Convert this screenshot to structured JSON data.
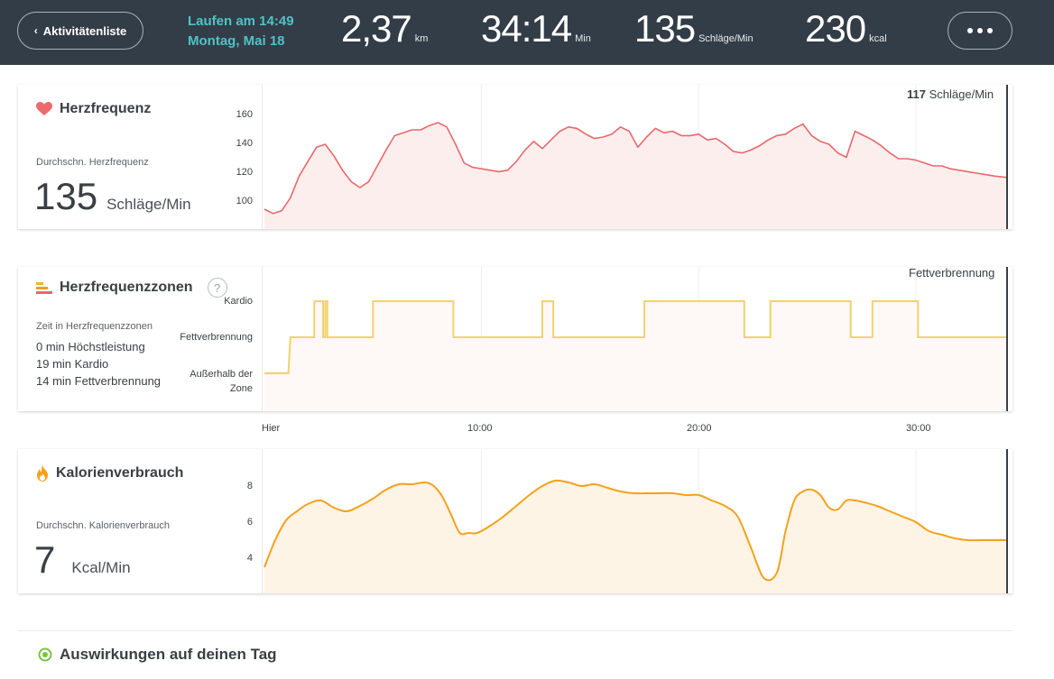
{
  "header": {
    "back_label": "Aktivitätenliste",
    "activity_line1": "Laufen am 14:49",
    "activity_line2": "Montag, Mai 18",
    "stats": [
      {
        "value": "2,37",
        "unit": "km"
      },
      {
        "value": "34:14",
        "unit": "Min"
      },
      {
        "value": "135",
        "unit": "Schläge/Min"
      },
      {
        "value": "230",
        "unit": "kcal"
      }
    ],
    "more_label": "•••"
  },
  "heart_rate": {
    "title": "Herzfrequenz",
    "sub_label": "Durchschn. Herzfrequenz",
    "avg_value": "135",
    "avg_unit": "Schläge/Min",
    "y_ticks": [
      "160",
      "140",
      "120",
      "100"
    ],
    "cursor_value": "117",
    "cursor_unit": "Schläge/Min",
    "color": "#e8686b"
  },
  "zones": {
    "title": "Herzfrequenzzonen",
    "help_label": "?",
    "sub_label": "Zeit in Herzfrequenzzonen",
    "lines": [
      "0 min Höchstleistung",
      "19 min Kardio",
      "14 min Fettverbrennung"
    ],
    "levels": [
      "Kardio",
      "Fettverbrennung",
      "Außerhalb der Zone"
    ],
    "cursor_label": "Fettverbrennung",
    "color": "#f0d36b"
  },
  "x_axis": [
    "Hier",
    "10:00",
    "20:00",
    "30:00"
  ],
  "calories": {
    "title": "Kalorienverbrauch",
    "sub_label": "Durchschn. Kalorienverbrauch",
    "avg_value": "7",
    "avg_unit": "Kcal/Min",
    "y_ticks": [
      "8",
      "6",
      "4"
    ],
    "color": "#f5a11c"
  },
  "footer": {
    "title": "Auswirkungen auf deinen Tag"
  },
  "chart_data": [
    {
      "type": "line",
      "title": "Herzfrequenz",
      "ylim": [
        90,
        170
      ],
      "xlim": [
        0,
        34.2
      ],
      "x": [
        0,
        0.4,
        0.8,
        1.2,
        1.6,
        2.0,
        2.4,
        2.8,
        3.2,
        3.6,
        4.0,
        4.4,
        4.8,
        5.2,
        5.6,
        6.0,
        6.4,
        6.8,
        7.2,
        7.6,
        8.0,
        8.4,
        8.8,
        9.2,
        9.6,
        10.0,
        10.4,
        10.8,
        11.2,
        11.6,
        12.0,
        12.4,
        12.8,
        13.2,
        13.6,
        14.0,
        14.4,
        14.8,
        15.2,
        15.6,
        16.0,
        16.4,
        16.8,
        17.2,
        17.6,
        18.0,
        18.4,
        18.8,
        19.2,
        19.6,
        20.0,
        20.4,
        20.8,
        21.2,
        21.6,
        22.0,
        22.4,
        22.8,
        23.2,
        23.6,
        24.0,
        24.4,
        24.8,
        25.2,
        25.6,
        26.0,
        26.4,
        26.8,
        27.2,
        27.6,
        28.0,
        28.4,
        28.8,
        29.2,
        29.6,
        30.0,
        30.4,
        30.8,
        31.2,
        31.6,
        32.0,
        32.4,
        32.8,
        33.2,
        33.6,
        34.2
      ],
      "y": [
        95,
        92,
        94,
        103,
        118,
        128,
        138,
        140,
        132,
        122,
        114,
        110,
        114,
        125,
        136,
        146,
        148,
        150,
        150,
        153,
        155,
        152,
        140,
        127,
        124,
        123,
        122,
        121,
        122,
        128,
        136,
        142,
        137,
        143,
        149,
        152,
        151,
        147,
        144,
        145,
        147,
        152,
        149,
        138,
        145,
        151,
        148,
        149,
        146,
        146,
        147,
        143,
        144,
        140,
        135,
        134,
        136,
        139,
        143,
        146,
        147,
        151,
        154,
        146,
        142,
        140,
        134,
        131,
        149,
        146,
        143,
        139,
        134,
        130,
        130,
        129,
        127,
        125,
        125,
        123,
        122,
        121,
        120,
        119,
        118,
        117
      ]
    },
    {
      "type": "line",
      "title": "Herzfrequenzzonen",
      "categories": [
        "Außerhalb der Zone",
        "Fettverbrennung",
        "Kardio"
      ],
      "xlim": [
        0,
        34.2
      ],
      "x": [
        0,
        1.1,
        1.2,
        2.3,
        2.3,
        2.7,
        2.7,
        2.8,
        2.8,
        2.9,
        2.9,
        5.0,
        5.0,
        8.7,
        8.7,
        12.8,
        12.8,
        13.3,
        13.3,
        17.5,
        17.5,
        17.8,
        17.8,
        22.1,
        22.1,
        23.3,
        23.3,
        27.0,
        27.0,
        28.0,
        28.0,
        30.1,
        30.1,
        34.2
      ],
      "y": [
        0,
        0,
        1,
        1,
        2,
        2,
        1,
        1,
        2,
        2,
        1,
        1,
        2,
        2,
        1,
        1,
        2,
        2,
        1,
        1,
        2,
        2,
        2,
        2,
        1,
        1,
        2,
        2,
        1,
        1,
        2,
        2,
        1,
        1
      ]
    },
    {
      "type": "area",
      "title": "Kalorienverbrauch",
      "ylim": [
        2.5,
        9.0
      ],
      "xlim": [
        0,
        34.2
      ],
      "x": [
        0,
        0.5,
        1.0,
        1.5,
        2.0,
        2.6,
        3.2,
        3.8,
        4.4,
        5.0,
        5.6,
        6.2,
        6.8,
        7.4,
        7.8,
        8.2,
        8.6,
        9.0,
        9.4,
        9.8,
        10.4,
        11.0,
        11.6,
        12.2,
        12.8,
        13.4,
        14.0,
        14.6,
        15.2,
        15.8,
        16.4,
        17.0,
        17.6,
        18.2,
        18.8,
        19.4,
        20.0,
        20.6,
        21.2,
        21.8,
        22.4,
        23.0,
        23.6,
        24.0,
        24.4,
        24.8,
        25.2,
        25.6,
        26.0,
        26.4,
        26.8,
        27.2,
        27.6,
        28.2,
        28.8,
        29.4,
        30.0,
        30.6,
        31.2,
        31.8,
        32.4,
        33.0,
        33.6,
        34.2
      ],
      "y": [
        3.5,
        5.0,
        6.1,
        6.6,
        7.0,
        7.2,
        6.8,
        6.6,
        6.9,
        7.3,
        7.8,
        8.1,
        8.1,
        8.2,
        8.0,
        7.4,
        6.4,
        5.4,
        5.4,
        5.4,
        5.8,
        6.3,
        6.9,
        7.5,
        8.0,
        8.3,
        8.2,
        8.0,
        8.1,
        7.9,
        7.7,
        7.6,
        7.6,
        7.6,
        7.6,
        7.5,
        7.5,
        7.2,
        6.9,
        6.3,
        4.6,
        2.9,
        3.2,
        5.5,
        7.2,
        7.7,
        7.8,
        7.5,
        6.8,
        6.7,
        7.2,
        7.2,
        7.1,
        6.9,
        6.6,
        6.3,
        6.0,
        5.5,
        5.3,
        5.1,
        5.0,
        5.0,
        5.0,
        5.0
      ]
    }
  ]
}
